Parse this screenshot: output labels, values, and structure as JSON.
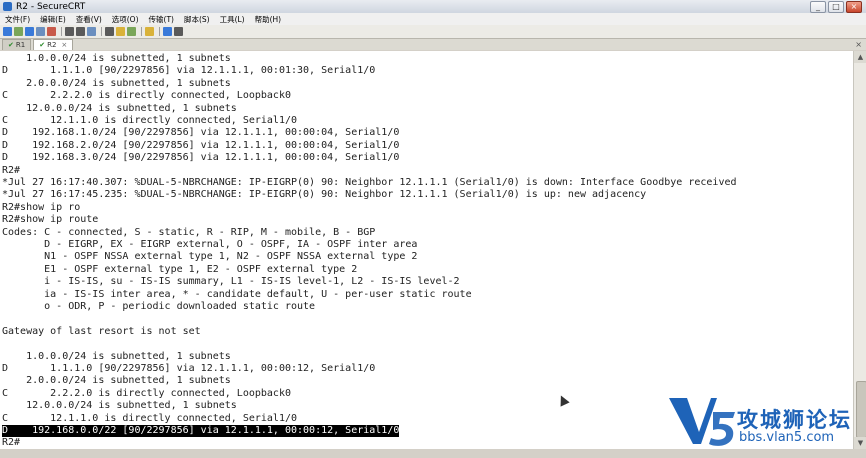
{
  "window": {
    "title": "R2 - SecureCRT",
    "min": "_",
    "max": "□",
    "close": "×"
  },
  "menu": [
    "文件(F)",
    "编辑(E)",
    "查看(V)",
    "选项(O)",
    "传输(T)",
    "脚本(S)",
    "工具(L)",
    "帮助(H)"
  ],
  "tabs": [
    {
      "label": "R1",
      "active": false
    },
    {
      "label": "R2",
      "active": true
    }
  ],
  "tab_close": "×",
  "terminal_lines": [
    "    1.0.0.0/24 is subnetted, 1 subnets",
    "D       1.1.1.0 [90/2297856] via 12.1.1.1, 00:01:30, Serial1/0",
    "    2.0.0.0/24 is subnetted, 1 subnets",
    "C       2.2.2.0 is directly connected, Loopback0",
    "    12.0.0.0/24 is subnetted, 1 subnets",
    "C       12.1.1.0 is directly connected, Serial1/0",
    "D    192.168.1.0/24 [90/2297856] via 12.1.1.1, 00:00:04, Serial1/0",
    "D    192.168.2.0/24 [90/2297856] via 12.1.1.1, 00:00:04, Serial1/0",
    "D    192.168.3.0/24 [90/2297856] via 12.1.1.1, 00:00:04, Serial1/0",
    "R2#",
    "*Jul 27 16:17:40.307: %DUAL-5-NBRCHANGE: IP-EIGRP(0) 90: Neighbor 12.1.1.1 (Serial1/0) is down: Interface Goodbye received",
    "*Jul 27 16:17:45.235: %DUAL-5-NBRCHANGE: IP-EIGRP(0) 90: Neighbor 12.1.1.1 (Serial1/0) is up: new adjacency",
    "R2#show ip ro",
    "R2#show ip route",
    "Codes: C - connected, S - static, R - RIP, M - mobile, B - BGP",
    "       D - EIGRP, EX - EIGRP external, O - OSPF, IA - OSPF inter area",
    "       N1 - OSPF NSSA external type 1, N2 - OSPF NSSA external type 2",
    "       E1 - OSPF external type 1, E2 - OSPF external type 2",
    "       i - IS-IS, su - IS-IS summary, L1 - IS-IS level-1, L2 - IS-IS level-2",
    "       ia - IS-IS inter area, * - candidate default, U - per-user static route",
    "       o - ODR, P - periodic downloaded static route",
    "",
    "Gateway of last resort is not set",
    "",
    "    1.0.0.0/24 is subnetted, 1 subnets",
    "D       1.1.1.0 [90/2297856] via 12.1.1.1, 00:00:12, Serial1/0",
    "    2.0.0.0/24 is subnetted, 1 subnets",
    "C       2.2.2.0 is directly connected, Loopback0",
    "    12.0.0.0/24 is subnetted, 1 subnets",
    "C       12.1.1.0 is directly connected, Serial1/0",
    "D    192.168.0.0/22 [90/2297856] via 12.1.1.1, 00:00:12, Serial1/0",
    "R2#"
  ],
  "highlighted_line": 30,
  "watermark": {
    "brand": "攻城狮论坛",
    "url": "bbs.vlan5.com"
  },
  "colors": {
    "logo_blue": "#1e63b8",
    "selection_bg": "#000000"
  }
}
